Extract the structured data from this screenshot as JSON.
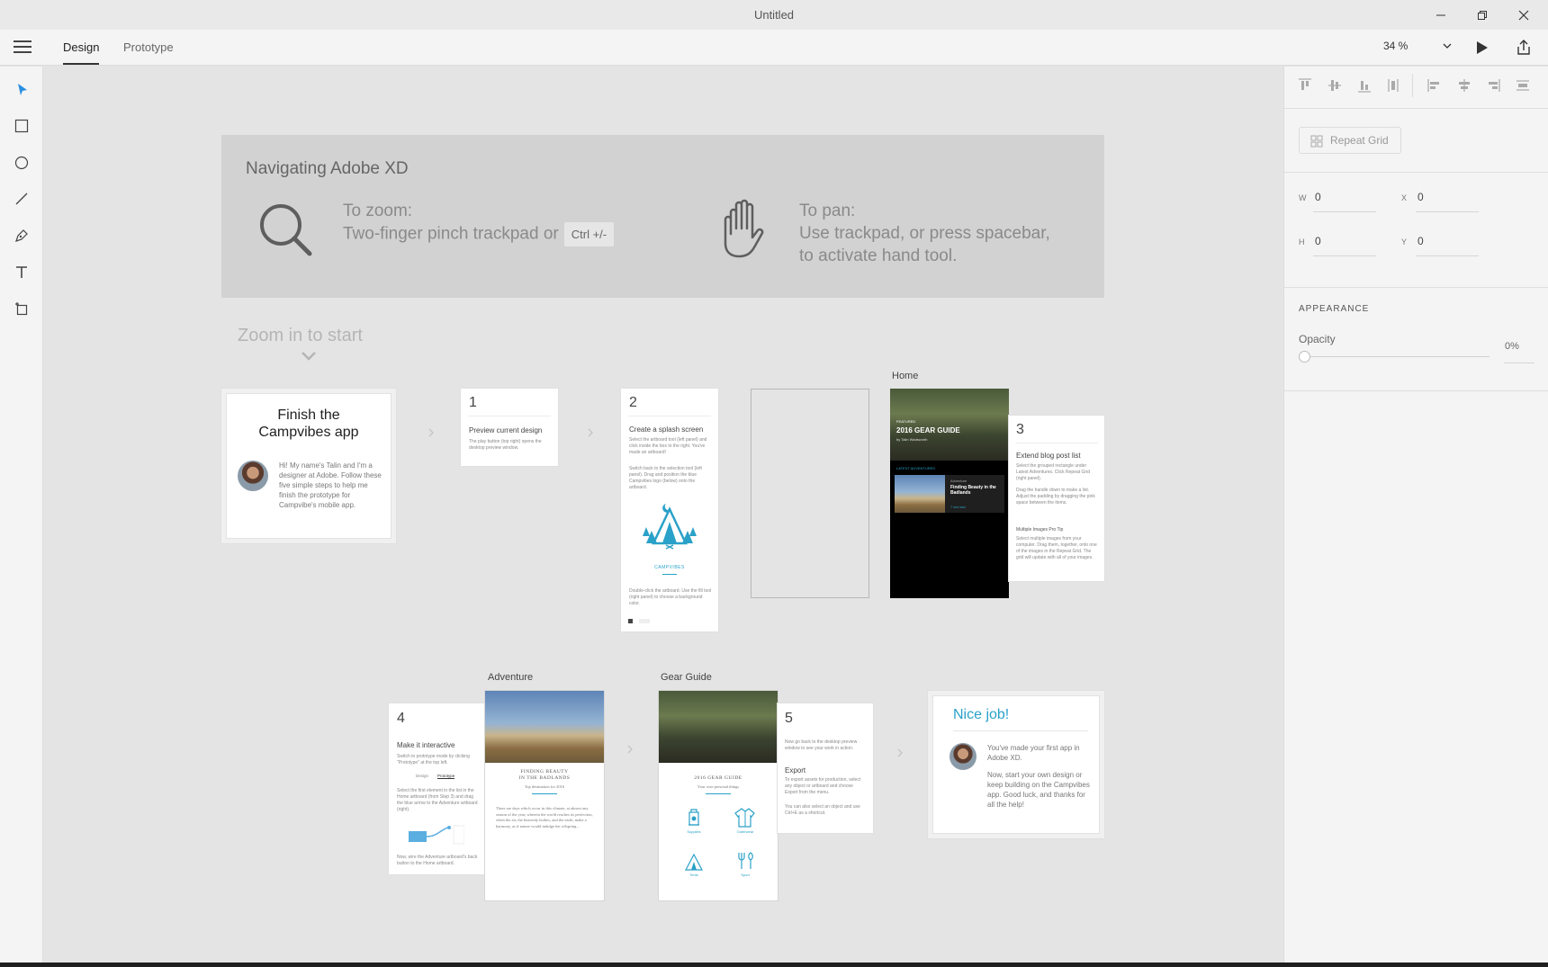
{
  "window": {
    "title": "Untitled"
  },
  "menubar": {
    "tabs": [
      {
        "label": "Design"
      },
      {
        "label": "Prototype"
      }
    ],
    "zoom": "34 %"
  },
  "banner": {
    "title": "Navigating Adobe XD",
    "zoom_heading": "To zoom:",
    "zoom_text": "Two-finger pinch trackpad or",
    "zoom_key": "Ctrl +/-",
    "pan_heading": "To pan:",
    "pan_line1": "Use trackpad, or press spacebar,",
    "pan_line2": "to activate hand tool."
  },
  "canvas": {
    "zoom_hint": "Zoom in to start",
    "intro": {
      "title_line1": "Finish the",
      "title_line2": "Campvibes app",
      "body": "Hi! My name's Talin and I'm a designer at Adobe. Follow these five simple steps to help me finish the prototype for Campvibe's mobile app."
    },
    "step1": {
      "num": "1",
      "title": "Preview current design",
      "text": "The play button (top right) opens the desktop preview window."
    },
    "step2": {
      "num": "2",
      "title": "Create a splash screen",
      "text1": "Select the artboard tool (left panel) and click inside the box to the right. You've made an artboard!",
      "text2": "Switch back to the selection tool (left panel). Drag and position the blue Campvibes logo (below) onto the artboard.",
      "logo": "CAMPVIBES",
      "text3": "Double-click the artboard. Use the fill tool (right panel) to choose a background color."
    },
    "home": {
      "label": "Home",
      "kicker": "FEATURED",
      "title": "2016 GEAR GUIDE",
      "byline": "by Talin Wadsworth",
      "section": "LATEST ADVENTURES",
      "item_kicker": "Adventure",
      "item_title": "Finding Beauty in the Badlands",
      "item_meta": "7 min read"
    },
    "step3": {
      "num": "3",
      "title": "Extend blog post list",
      "text1": "Select the grouped rectangle under Latest Adventures. Click Repeat Grid (right panel).",
      "text2": "Drag the handle down to make a list. Adjust the padding by dragging the pink space between the items.",
      "tip_title": "Multiple Images Pro Tip",
      "tip_text": "Select multiple images from your computer. Drag them, together, onto one of the images in the Repeat Grid. The grid will update with all of your images."
    },
    "step4": {
      "num": "4",
      "title": "Make it interactive",
      "text1": "Switch to prototype mode by clicking \"Prototype\" at the top left.",
      "mini_tab1": "Design",
      "mini_tab2": "Prototype",
      "text2": "Select the first element in the list in the Home artboard (from Step 3) and drag the blue arrow to the Adventure artboard (right).",
      "text3": "Now, wire the Adventure artboard's back button to the Home artboard."
    },
    "adventure": {
      "label": "Adventure",
      "title_line1": "FINDING BEAUTY",
      "title_line2": "IN THE BADLANDS",
      "subtitle": "Top destination for 2016",
      "body": "There are days which occur in this climate, at almost any season of the year, wherein the world reaches its perfection, when the air, the heavenly bodies, and the earth, make a harmony, as if nature would indulge her offspring..."
    },
    "gear": {
      "label": "Gear Guide",
      "title": "2016 GEAR GUIDE",
      "subtitle": "Your own personal things",
      "icons": [
        "Supplies",
        "Outerwear",
        "Tents",
        "Sport"
      ]
    },
    "step5": {
      "num": "5",
      "text1": "Now go back to the desktop preview window to see your work in action.",
      "export_title": "Export",
      "text2": "To export assets for production, select any object or artboard and choose Export from the menu.",
      "text3": "You can also select an object and use Ctrl+E as a shortcut."
    },
    "done": {
      "title": "Nice job!",
      "p1": "You've made your first app in Adobe XD.",
      "p2": "Now, start your own design or keep building on the Campvibes app. Good luck, and thanks for all the help!"
    }
  },
  "panel": {
    "repeat_grid": "Repeat Grid",
    "w_label": "W",
    "w_value": "0",
    "x_label": "X",
    "x_value": "0",
    "h_label": "H",
    "h_value": "0",
    "y_label": "Y",
    "y_value": "0",
    "appearance": "APPEARANCE",
    "opacity_label": "Opacity",
    "opacity_value": "0%",
    "opacity_fraction": 0
  },
  "colors": {
    "accent": "#2aa1c8",
    "canvas": "#e4e4e4",
    "panel": "#f4f4f4"
  }
}
